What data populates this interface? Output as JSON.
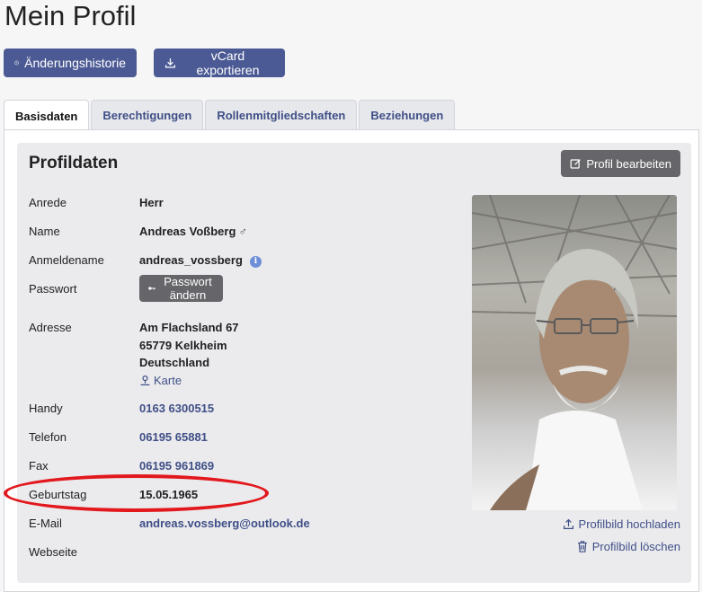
{
  "page": {
    "title": "Mein Profil"
  },
  "toolbar": {
    "history_label": "Änderungshistorie",
    "vcard_label": "vCard exportieren"
  },
  "tabs": [
    {
      "label": "Basisdaten",
      "active": true
    },
    {
      "label": "Berechtigungen",
      "active": false
    },
    {
      "label": "Rollenmitgliedschaften",
      "active": false
    },
    {
      "label": "Beziehungen",
      "active": false
    }
  ],
  "card": {
    "title": "Profildaten",
    "edit_label": "Profil bearbeiten"
  },
  "profile": {
    "salutation": {
      "label": "Anrede",
      "value": "Herr"
    },
    "name": {
      "label": "Name",
      "value": "Andreas Voßberg",
      "gender_symbol": "♂"
    },
    "username": {
      "label": "Anmeldename",
      "value": "andreas_vossberg",
      "info_icon": "i"
    },
    "password": {
      "label": "Passwort",
      "button_label": "Passwort ändern"
    },
    "address": {
      "label": "Adresse",
      "street": "Am Flachsland 67",
      "city": "65779 Kelkheim",
      "country": "Deutschland",
      "map_label": "Karte"
    },
    "mobile": {
      "label": "Handy",
      "value": "0163 6300515"
    },
    "phone": {
      "label": "Telefon",
      "value": "06195 65881"
    },
    "fax": {
      "label": "Fax",
      "value": "06195 961869"
    },
    "birthday": {
      "label": "Geburtstag",
      "value": "15.05.1965"
    },
    "email": {
      "label": "E-Mail",
      "value": "andreas.vossberg@outlook.de"
    },
    "website": {
      "label": "Webseite",
      "value": ""
    }
  },
  "photo_actions": {
    "upload_label": "Profilbild hochladen",
    "delete_label": "Profilbild löschen"
  },
  "colors": {
    "primary": "#4b5a94",
    "link": "#3f4f86",
    "secondary_button": "#66666a",
    "highlight": "#e2181d"
  }
}
